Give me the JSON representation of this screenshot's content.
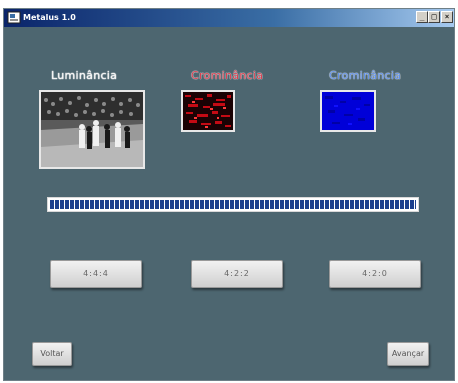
{
  "window": {
    "title": "Metalus 1.0",
    "controls": {
      "minimize": "_",
      "maximize": "□",
      "close": "×"
    }
  },
  "channels": [
    {
      "label": "Luminância",
      "color": "#f4f4f4",
      "preview": "grayscale basketball frame"
    },
    {
      "label": "Crominância",
      "color": "#d74050",
      "preview": "red chroma frame"
    },
    {
      "label": "Crominância",
      "color": "#5f8fe8",
      "preview": "blue chroma frame"
    }
  ],
  "progress": {
    "value": 1.0
  },
  "sampling_options": [
    {
      "label": "4:4:4"
    },
    {
      "label": "4:2:2"
    },
    {
      "label": "4:2:0"
    }
  ],
  "navigation": {
    "back_label": "Voltar",
    "next_label": "Avançar"
  },
  "colors": {
    "window_bg": "#4d6670",
    "titlebar": "#0a246a",
    "progress_fill": "#1a3e8c"
  }
}
